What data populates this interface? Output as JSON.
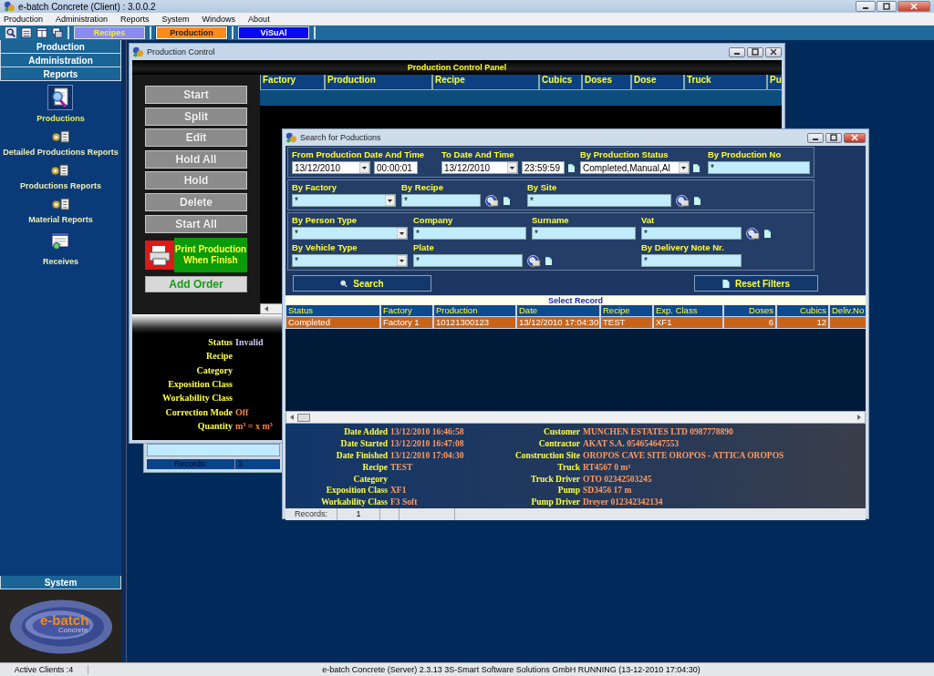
{
  "app": {
    "title": "e-batch Concrete (Client) : 3.0.0.2"
  },
  "menu": [
    "Production",
    "Administration",
    "Reports",
    "System",
    "Windows",
    "About"
  ],
  "toolbar": {
    "tabs": [
      {
        "label": "Recipes",
        "color": "#8c8cf0",
        "selected": false
      },
      {
        "label": "Production",
        "color": "#ff8c1a",
        "selected": true
      },
      {
        "label": "ViSuAl",
        "color": "#0a0af0",
        "selected": false
      }
    ]
  },
  "sidebar": {
    "sections": [
      {
        "label": "Production"
      },
      {
        "label": "Administration"
      },
      {
        "label": "Reports",
        "items": [
          {
            "label": "Productions",
            "kind": "search",
            "selected": true
          },
          {
            "label": "Detailed Productions Reports",
            "kind": "report",
            "selected": false
          },
          {
            "label": "Productions Reports",
            "kind": "report",
            "selected": false
          },
          {
            "label": "Material Reports",
            "kind": "report",
            "selected": false
          },
          {
            "label": "Receives",
            "kind": "window",
            "selected": false
          }
        ]
      }
    ],
    "footer_section": "System",
    "logo": {
      "text": "e-batch",
      "subtext": "Concrete"
    }
  },
  "production_control": {
    "title": "Production Control",
    "panel_title": "Production Control Panel",
    "actions": [
      {
        "label": "Start",
        "disabled": true
      },
      {
        "label": "Split",
        "disabled": true
      },
      {
        "label": "Edit",
        "disabled": true
      },
      {
        "label": "Hold All",
        "disabled": true
      },
      {
        "label": "Hold",
        "disabled": true
      },
      {
        "label": "Delete",
        "disabled": true
      },
      {
        "label": "Start All",
        "disabled": true
      }
    ],
    "print_button": "Print Production When Finish",
    "add_order_button": "Add Order",
    "columns": [
      "Factory",
      "Production",
      "Recipe",
      "Cubics",
      "Doses",
      "Dose",
      "Truck",
      "Pu"
    ],
    "info": [
      {
        "label": "Status",
        "value": "Invalid",
        "color": "#c8c8f0"
      },
      {
        "label": "Recipe"
      },
      {
        "label": "Category"
      },
      {
        "label": "Exposition Class"
      },
      {
        "label": "Workability Class"
      },
      {
        "label": "Correction Mode",
        "value": "Off",
        "color": "#ff8040"
      },
      {
        "label": "Quantity",
        "value": "m³ =  x  m³",
        "color": "#ff8040"
      }
    ]
  },
  "background_window": {
    "records_label": "Records:",
    "records_count": "2"
  },
  "search_window": {
    "title": "Search for Poductions",
    "filter_groups": [
      {
        "rows": [
          [
            {
              "label": "From Production Date And Time",
              "kind": "date",
              "value": "13/12/2010",
              "time": "00:00:01",
              "lookup": false,
              "clear": false
            },
            {
              "label": "To Date And Time",
              "kind": "date",
              "value": "13/12/2010",
              "time": "23:59:59",
              "lookup": false,
              "clear": true
            },
            {
              "label": "By Production Status",
              "kind": "select",
              "value": "Completed,Manual,Al",
              "lookup": false,
              "clear": true
            },
            {
              "label": "By Production No",
              "kind": "text",
              "value": "*",
              "lookup": false,
              "clear": false
            }
          ]
        ]
      },
      {
        "rows": [
          [
            {
              "label": "By Factory",
              "kind": "select",
              "value": "*",
              "lookup": false,
              "clear": false
            },
            {
              "label": "By Recipe",
              "kind": "text",
              "value": "*",
              "lookup": true,
              "clear": true
            },
            {
              "label": "By Site",
              "kind": "text",
              "value": "*",
              "lookup": true,
              "clear": true
            }
          ]
        ]
      },
      {
        "rows": [
          [
            {
              "label": "By Person Type",
              "kind": "select",
              "value": "*",
              "lookup": false,
              "clear": false
            },
            {
              "label": "Company",
              "kind": "text",
              "value": "*",
              "lookup": false,
              "clear": false
            },
            {
              "label": "Surname",
              "kind": "text",
              "value": "*",
              "lookup": false,
              "clear": false
            },
            {
              "label": "Vat",
              "kind": "text",
              "value": "*",
              "lookup": true,
              "clear": true
            }
          ],
          [
            {
              "label": "By Vehicle Type",
              "kind": "select",
              "value": "*",
              "lookup": false,
              "clear": false
            },
            {
              "label": "Plate",
              "kind": "text",
              "value": "*",
              "lookup": true,
              "clear": true
            },
            "",
            {
              "label": "By Delivery Note Nr.",
              "kind": "text",
              "value": "*",
              "lookup": false,
              "clear": false
            }
          ]
        ]
      }
    ],
    "search_button": "Search",
    "reset_button": "Reset Filters",
    "results": {
      "title": "Select Record",
      "columns": [
        "Status",
        "Factory",
        "Production",
        "Date",
        "Recipe",
        "Exp. Class",
        "Doses",
        "Cubics",
        "Deliv.No"
      ],
      "rows": [
        {
          "cells": [
            "Completed",
            "Factory 1",
            "10121300123",
            "13/12/2010 17:04:30",
            "TEST",
            "XF1",
            "6",
            "12",
            ""
          ],
          "selected": true
        }
      ]
    },
    "details_left": [
      {
        "label": "Date Added",
        "value": "13/12/2010 16:46:58"
      },
      {
        "label": "Date Started",
        "value": "13/12/2010 16:47:08"
      },
      {
        "label": "Date Finished",
        "value": "13/12/2010 17:04:30"
      },
      {
        "label": "Recipe",
        "value": "TEST"
      },
      {
        "label": "Category"
      },
      {
        "label": "Exposition Class",
        "value": "XF1"
      },
      {
        "label": "Workability Class",
        "value": "F3 Soft"
      }
    ],
    "details_right": [
      {
        "label": "Customer",
        "value": "MUNCHEN ESTATES LTD  0987778890"
      },
      {
        "label": "Contractor",
        "value": "AKAT S.A.  054654647553"
      },
      {
        "label": "Construction Site",
        "value": "OROPOS CAVE SITE OROPOS - ATTICA OROPOS"
      },
      {
        "label": "Truck",
        "value": "RT4567 0 m³"
      },
      {
        "label": "Truck Driver",
        "value": "OTO 02342503245"
      },
      {
        "label": "Pump",
        "value": "SD3456 17 m"
      },
      {
        "label": "Pump Driver",
        "value": "Dreyer 012342342134"
      }
    ],
    "status": {
      "records_label": "Records:",
      "records_count": "1"
    }
  },
  "status_bar": {
    "clients": "Active Clients :4",
    "server": "e-batch Concrete (Server)  2.3.13 3S-Smart Software Solutions GmbH RUNNING (13-12-2010 17:04:30)"
  }
}
